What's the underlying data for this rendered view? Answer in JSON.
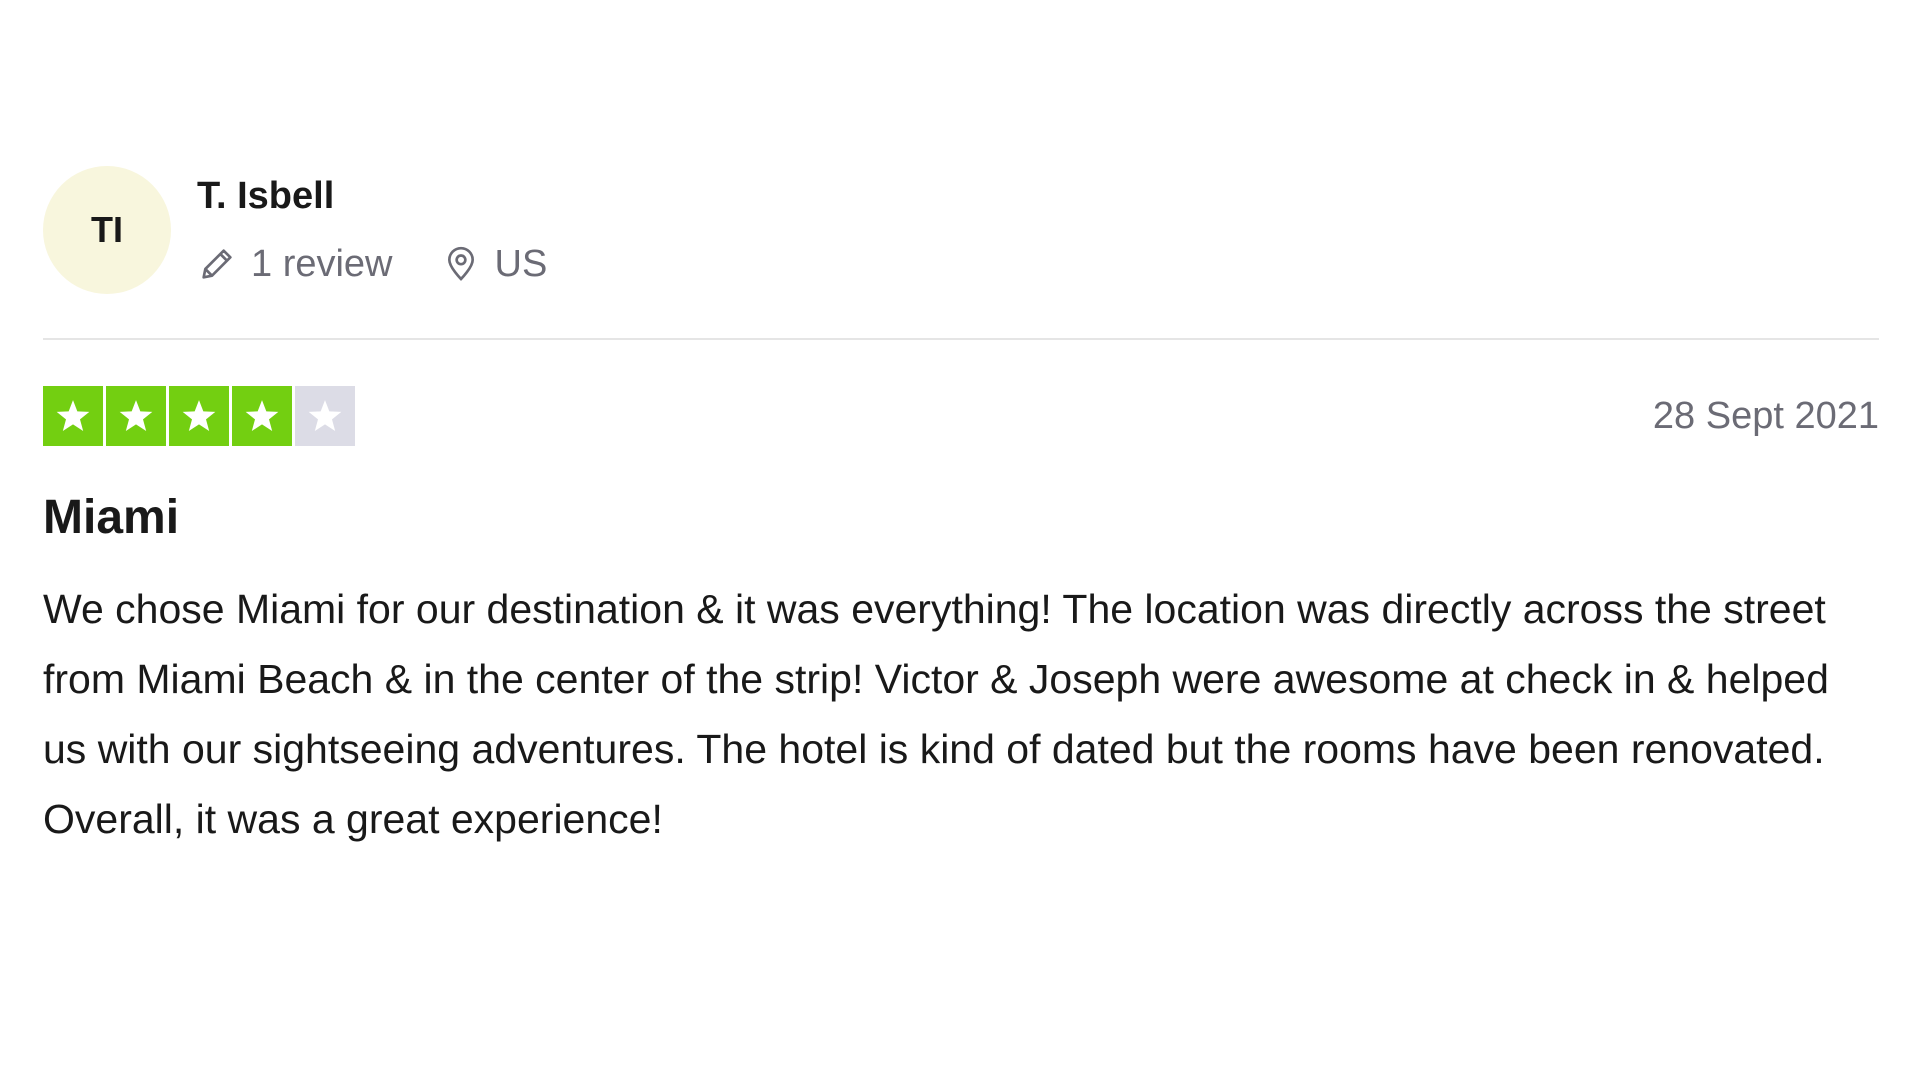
{
  "consumer": {
    "initials": "TI",
    "name": "T. Isbell",
    "review_count_label": "1 review",
    "country": "US",
    "icons": [
      "pencil-icon",
      "location-pin-icon"
    ]
  },
  "review": {
    "rating": 4,
    "max_rating": 5,
    "date": "28 Sept 2021",
    "title": "Miami",
    "text": "We chose Miami for our destination & it was everything! The location was directly across the street from Miami Beach & in the center of the strip! Victor & Joseph were awesome at check in & helped us with our sightseeing adventures. The hotel is kind of dated but the rooms have been renovated. Overall, it was a great experience!"
  },
  "colors": {
    "star_filled": "#73cf11",
    "star_empty": "#dcdce6",
    "avatar_bg": "#f8f6dd",
    "meta_text": "#6b6b75"
  }
}
